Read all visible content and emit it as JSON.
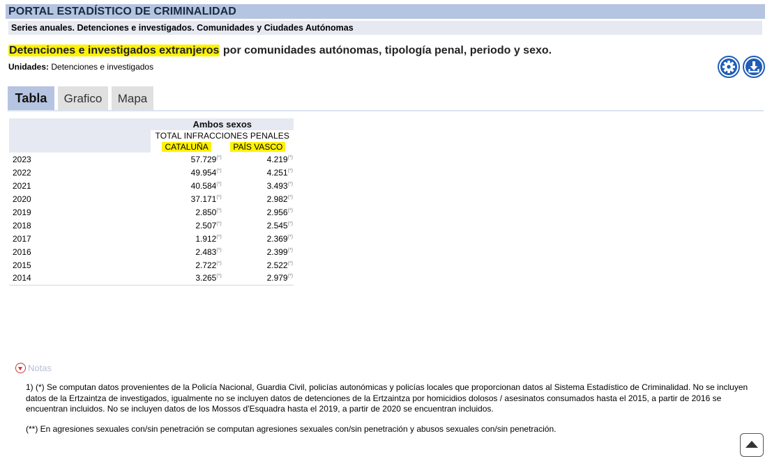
{
  "header": {
    "portal_title": "PORTAL ESTADÍSTICO DE CRIMINALIDAD",
    "series_title": "Series anuales. Detenciones e investigados. Comunidades y Ciudades Autónomas"
  },
  "main": {
    "title_highlight": "Detenciones e investigados extranjeros",
    "title_rest": " por comunidades autónomas, tipología penal, periodo y sexo.",
    "units_label": "Unidades:",
    "units_value": " Detenciones e investigados"
  },
  "icons": {
    "settings": "gear-icon",
    "download": "download-icon",
    "notes": "chevron-down-icon",
    "scroll": "arrow-up-icon"
  },
  "colors": {
    "header_bar": "#b5c4e0",
    "highlight": "#fff200",
    "accent": "#1e5db8",
    "notes_toggle": "#c0353a"
  },
  "tabs": [
    {
      "label": "Tabla",
      "active": true
    },
    {
      "label": "Grafico",
      "active": false
    },
    {
      "label": "Mapa",
      "active": false
    }
  ],
  "table": {
    "sex_header": "Ambos sexos",
    "crime_header": "TOTAL INFRACCIONES PENALES",
    "columns": [
      "CATALUÑA",
      "PAÍS VASCO"
    ],
    "note_marker": "(*)",
    "rows": [
      {
        "year": "2023",
        "values": [
          "57.729",
          "4.219"
        ]
      },
      {
        "year": "2022",
        "values": [
          "49.954",
          "4.251"
        ]
      },
      {
        "year": "2021",
        "values": [
          "40.584",
          "3.493"
        ]
      },
      {
        "year": "2020",
        "values": [
          "37.171",
          "2.982"
        ]
      },
      {
        "year": "2019",
        "values": [
          "2.850",
          "2.956"
        ]
      },
      {
        "year": "2018",
        "values": [
          "2.507",
          "2.545"
        ]
      },
      {
        "year": "2017",
        "values": [
          "1.912",
          "2.369"
        ]
      },
      {
        "year": "2016",
        "values": [
          "2.483",
          "2.399"
        ]
      },
      {
        "year": "2015",
        "values": [
          "2.722",
          "2.522"
        ]
      },
      {
        "year": "2014",
        "values": [
          "3.265",
          "2.979"
        ]
      }
    ]
  },
  "notes": {
    "toggle_label": "Notas",
    "note_1": "1) (*) Se computan datos provenientes de la Policía Nacional, Guardia Civil, policías autonómicas y policías locales que proporcionan datos al Sistema Estadístico de Criminalidad. No se incluyen datos de la Ertzaintza de investigados, igualmente no se incluyen datos de detenciones de la Ertzaintza por homicidios dolosos / asesinatos consumados hasta el 2015, a partir de 2016 se encuentran incluidos. No se incluyen datos de los Mossos d'Esquadra hasta el 2019, a partir de 2020 se encuentran incluidos.",
    "note_2": "(**) En agresiones sexuales con/sin penetración se computan agresiones sexuales con/sin penetración y abusos sexuales con/sin penetración."
  }
}
